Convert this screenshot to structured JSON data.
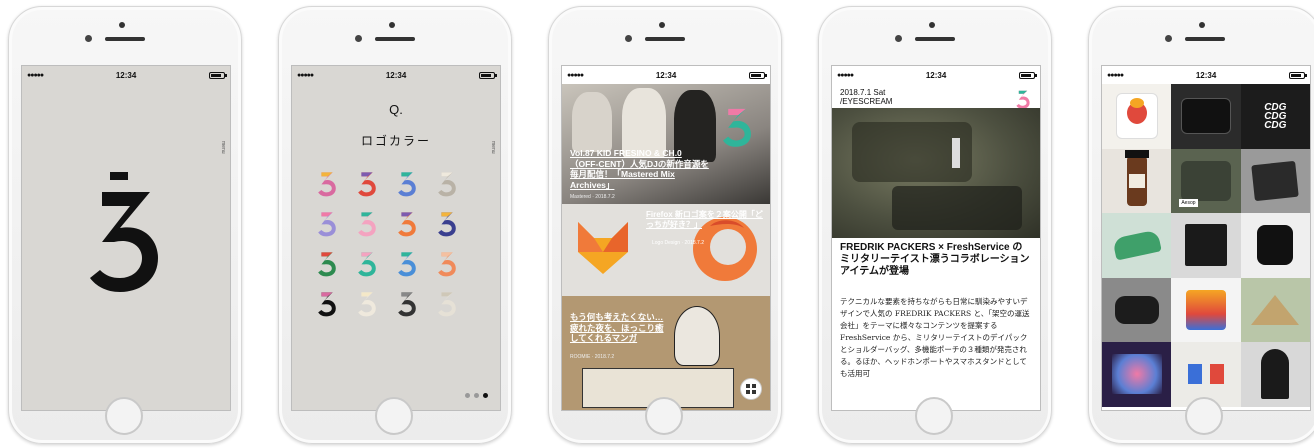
{
  "status": {
    "time": "12:34",
    "signal": "●●●●●"
  },
  "screen1": {
    "side_menu": "menu"
  },
  "screen2": {
    "title": "Q.",
    "subtitle": "ロゴカラー",
    "side_menu": "menu"
  },
  "screen3": {
    "article1_title": "Vol.87 KID FRESINO & CH.0（OFF-CENT）人気DJの新作音源を毎月配信！「Mastered Mix Archives」",
    "article1_meta": "Mastered · 2018.7.2",
    "article2_caption": "Firefox 新ロゴ案を２案公開「どっちが好き？」",
    "article2_meta": "Logo Design · 2018.7.2",
    "article3_title": "もう何も考えたくない…疲れた夜を、ほっこり癒してくれるマンガ",
    "article3_meta": "ROOMIE · 2018.7.2"
  },
  "screen4": {
    "date": "2018.7.1 Sat",
    "category": "/EYESCREAM",
    "headline": "FREDRIK PACKERS × FreshService のミリタリーテイスト漂うコラボレーションアイテムが登場",
    "body": "テクニカルな要素を持ちながらも日常に馴染みやすいデザインで人気の FREDRIK PACKERS と、「架空の運送会社」をテーマに様々なコンテンツを提案する FreshService から、ミリタリーテイストのデイパックとショルダーバッグ、多機能ポーチの３種類が発売される。るほか、ヘッドホンポートやスマホスタンドとしても活用可"
  },
  "screen5": {
    "cdg_line1": "CDG",
    "cdg_line2": "CDG",
    "cdg_line3": "CDG",
    "tile_brand": "Aesop"
  },
  "colors": {
    "bg_grey": "#d9d7d3",
    "accent_teal": "#2fb59a",
    "accent_orange": "#f07a3a"
  }
}
